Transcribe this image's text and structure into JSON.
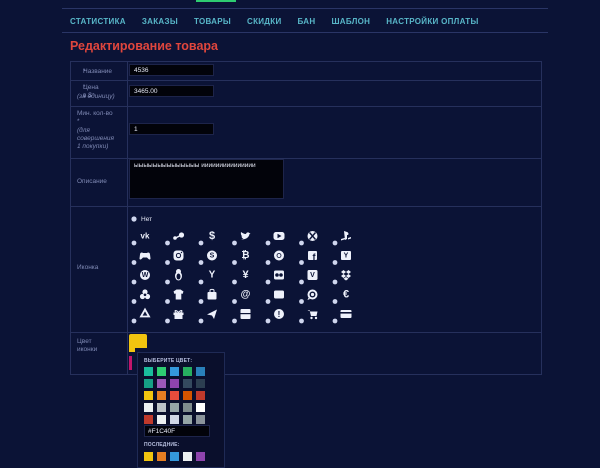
{
  "nav": [
    "СТАТИСТИКА",
    "ЗАКАЗЫ",
    "ТОВАРЫ",
    "СКИДКИ",
    "БАН",
    "ШАБЛОН",
    "НАСТРОЙКИ ОПЛАТЫ"
  ],
  "page_title": "Редактирование товара",
  "form": {
    "name": {
      "label": "Название",
      "required": "*",
      "value": "4536"
    },
    "price": {
      "label": "Цена в $",
      "required": "*",
      "note": "(за единицу)",
      "value": "3465.00"
    },
    "min_qty": {
      "label_1": "Мин. кол-во",
      "required": "*",
      "note_1": "(для",
      "note_2": "совершения",
      "note_3": "1 покупки)",
      "value": "1"
    },
    "description": {
      "label": "Описание",
      "value": "ыыыыыыыыыыыыыы иииииииииииииии"
    },
    "icon": {
      "label": "Иконка",
      "none_label": "Нет"
    },
    "color": {
      "label_1": "Цвет",
      "label_2": "иконки"
    }
  },
  "icon_names": [
    [
      "vk-icon",
      "steam-icon",
      "dollar-icon",
      "twitter-icon",
      "youtube-icon",
      "xbox-icon",
      "playstation-icon",
      "apple-icon",
      "twitch-icon"
    ],
    [
      "gamepad-icon",
      "instagram-icon",
      "skype-icon",
      "bitcoin-icon",
      "chrome-icon",
      "facebook-icon",
      "yahoo-icon",
      "paypal-icon",
      "windows-icon"
    ],
    [
      "wordpress-icon",
      "linux-icon",
      "yandex-icon",
      "yen-icon",
      "flickr-icon",
      "vine-icon",
      "dropbox-icon",
      "star-icon",
      "barcode-icon"
    ],
    [
      "biohazard-icon",
      "shirt-icon",
      "shopping-bag-icon",
      "at-icon",
      "wallet-icon",
      "whatsapp-icon",
      "euro-icon",
      "google-icon",
      "bug-icon"
    ],
    [
      "recycle-icon",
      "gift-icon",
      "send-icon",
      "gift-box-icon",
      "alert-icon",
      "cart-icon",
      "credit-card-icon",
      "fire-icon",
      "android-bot-icon"
    ],
    [
      "key-icon",
      "outlet-icon",
      "cc-icon",
      "pencil-icon",
      "hand-icon"
    ]
  ],
  "color_picker": {
    "current": "#F1C40F",
    "choose_label": "ВЫБЕРИТЕ ЦВЕТ:",
    "recent_label": "ПОСЛЕДНИЕ:",
    "hex_value": "#F1C40F",
    "palette": [
      [
        "#1abc9c",
        "#2ecc71",
        "#3498db",
        "#27ae60",
        "#2980b9"
      ],
      [
        "#16a085",
        "#9b59b6",
        "#8e44ad",
        "#34495e",
        "#2c3e50"
      ],
      [
        "#f1c40f",
        "#e67e22",
        "#e74c3c",
        "#d35400",
        "#c0392b"
      ],
      [
        "#ecf0f1",
        "#bdc3c7",
        "#95a5a6",
        "#7f8c8d",
        "#ffffff"
      ],
      [
        "#c0392b",
        "#ecf0f1",
        "#d0d7e6",
        "#95a5a6",
        "#8a939b"
      ]
    ],
    "recent": [
      "#f1c40f",
      "#e67e22",
      "#3498db",
      "#ecf0f1",
      "#8e44ad"
    ]
  }
}
